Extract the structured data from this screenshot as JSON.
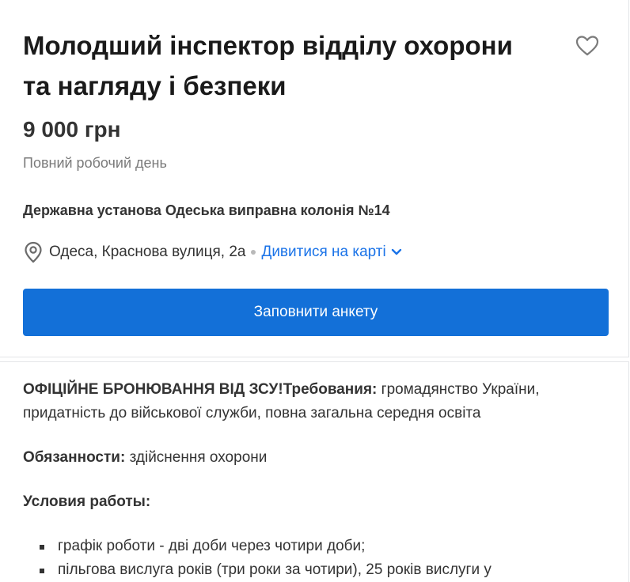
{
  "job": {
    "title": "Молодший інспектор відділу охорони та нагляду і безпеки",
    "salary": "9 000 грн",
    "schedule": "Повний робочий день",
    "company": "Державна установа Одеська виправна колонія №14",
    "address": "Одеса, Краснова вулиця, 2а",
    "map_link": "Дивитися на карті",
    "apply_label": "Заповнити анкету"
  },
  "description": {
    "requirements_label": "ОФІЦІЙНЕ БРОНЮВАННЯ ВІД ЗСУ!Требования:",
    "requirements_text": " громадянство України, придатність до військової служби, повна загальна середня освіта",
    "duties_label": "Обязанности:",
    "duties_text": " здійснення охорони",
    "conditions_label": "Условия работы:",
    "conditions": [
      "графік роботи - дві доби через чотири доби;",
      "пільгова вислуга років (три роки за чотири), 25 років вислуги у"
    ]
  },
  "icons": {
    "favorite": "heart-outline-icon",
    "location": "map-pin-icon",
    "expand": "chevron-down-icon"
  },
  "colors": {
    "accent": "#1370d8",
    "link": "#1a73e8",
    "muted": "#7a7a7a"
  }
}
